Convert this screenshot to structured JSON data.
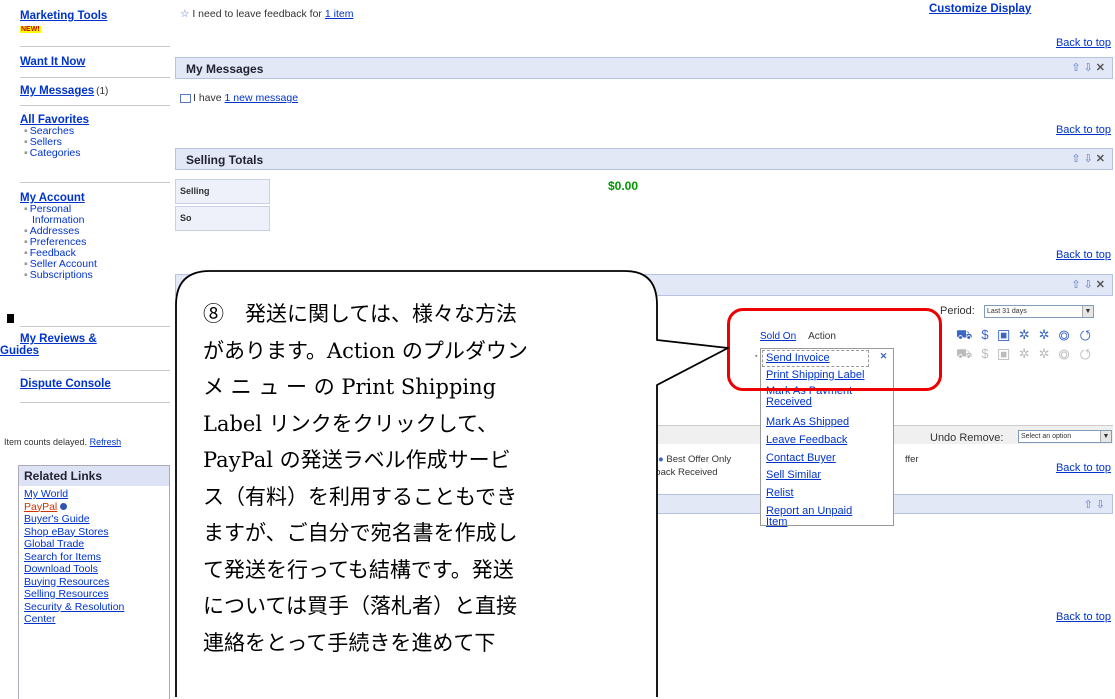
{
  "left_nav": {
    "marketing_tools": "Marketing Tools",
    "new_badge": "NEW!",
    "want_it_now": "Want It Now",
    "my_messages": "My Messages",
    "my_messages_count": "(1)",
    "all_favorites": "All Favorites",
    "favorites_items": [
      "Searches",
      "Sellers",
      "Categories"
    ],
    "my_account": "My Account",
    "account_items": [
      "Personal",
      "Information",
      "Addresses",
      "Preferences",
      "Feedback",
      "Seller Account",
      "Subscriptions"
    ],
    "my_reviews": "My Reviews &",
    "guides": "Guides",
    "dispute_console": "Dispute Console",
    "delayed_text": "Item counts delayed.",
    "refresh": "Refresh"
  },
  "related_links": {
    "title": "Related Links",
    "items": [
      "My World",
      "PayPal",
      "Buyer's Guide",
      "Shop eBay Stores",
      "Global Trade",
      "Search for Items",
      "Download Tools",
      "Buying Resources",
      "Selling Resources",
      "Security & Resolution",
      "Center"
    ]
  },
  "feedback_line": {
    "text": "I need to leave feedback for",
    "link": "1 item"
  },
  "back_to_top": "Back to top",
  "messages": {
    "title": "My Messages",
    "text": "I have",
    "link": "1 new message"
  },
  "selling_totals": {
    "title": "Selling Totals",
    "row1_label": "Selling",
    "row2_label": "So",
    "amount": "$0.00"
  },
  "selling": {
    "customize": "Customize Display",
    "period_label": "Period:",
    "period_value": "Last 31 days",
    "sold_on": "Sold On",
    "action": "Action",
    "undo_remove": "Undo Remove:",
    "undo_value": "Select an option",
    "best_offer": "Best Offer Only",
    "feedback_received": "dback Received",
    "offer": "ffer"
  },
  "action_menu": {
    "items": [
      "Send Invoice",
      "Print Shipping Label",
      "Mark As Payment",
      "Received",
      "Mark As Shipped",
      "Leave Feedback",
      "Contact Buyer",
      "Sell Similar",
      "Relist",
      "Report an Unpaid",
      "Item"
    ]
  },
  "callout": {
    "lines": [
      "⑧　発送に関しては、様々な方法",
      "があります。Action のプルダウン",
      "メ ニ ュ ー の Print Shipping",
      "Label リンクをクリックして、",
      "PayPal の発送ラベル作成サービ",
      "ス（有料）を利用することもでき",
      "ますが、ご自分で宛名書を作成し",
      "て発送を行っても結構です。発送",
      "については買手（落札者）と直接",
      "連絡をとって手続きを進めて下"
    ]
  },
  "colors": {
    "link": "#0033cc",
    "header_bg": "#e3e8f7",
    "highlight_frame": "#ee0000",
    "amount": "#009900"
  }
}
